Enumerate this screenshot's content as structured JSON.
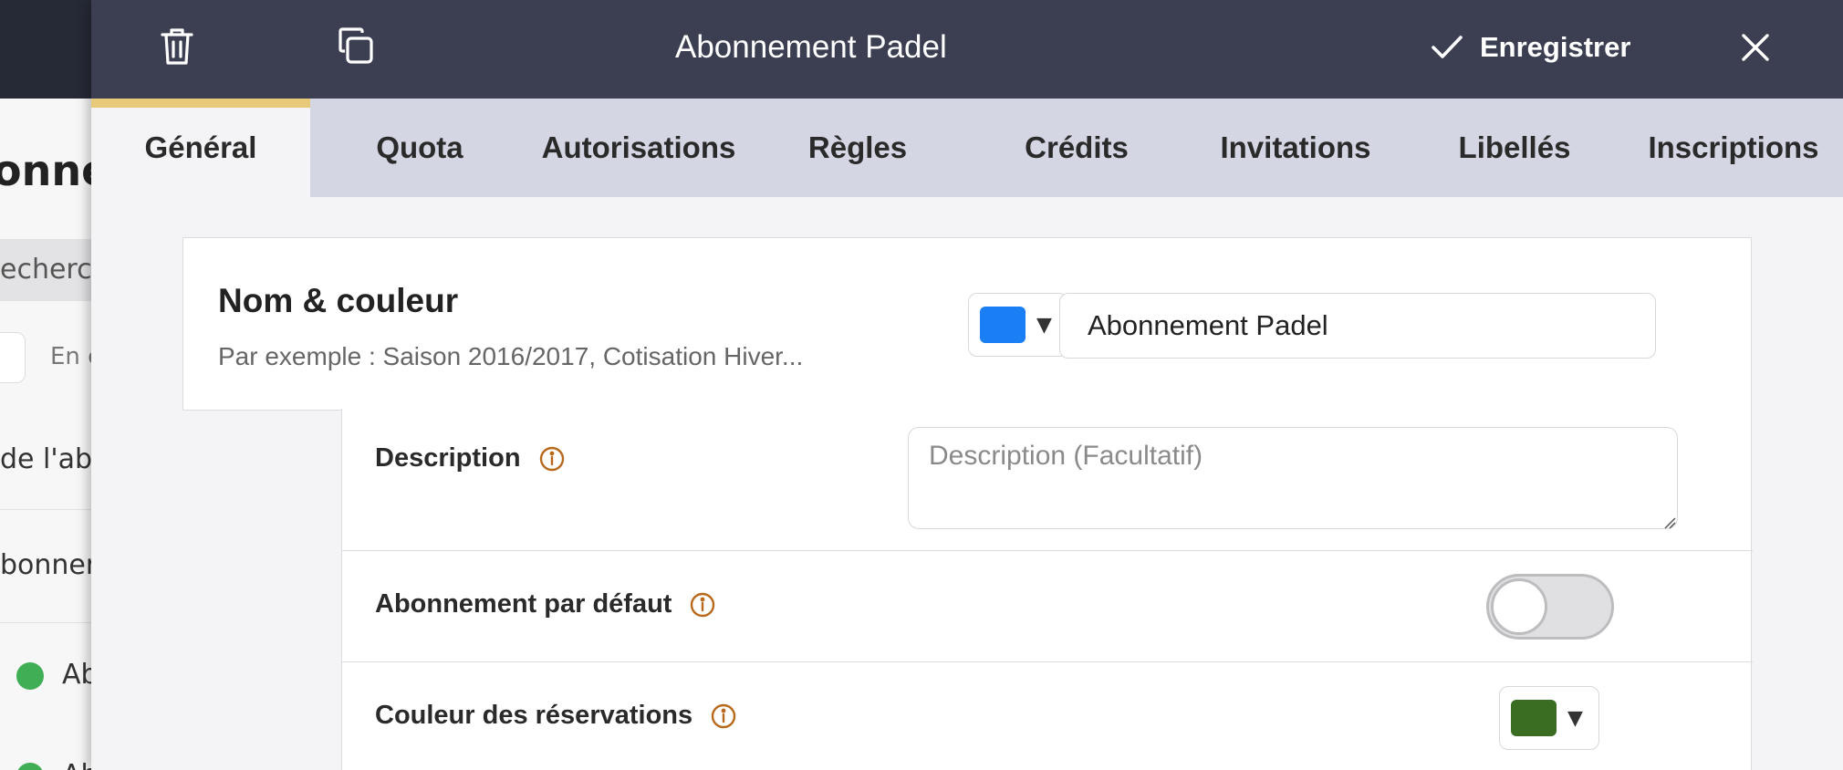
{
  "background": {
    "title_fragment": "onne",
    "search_fragment": "echercl",
    "chip_fragment": "En c",
    "row1_fragment": "de l'abo",
    "row2_fragment": "bonner",
    "item1_fragment": "Ab",
    "item2_fragment": "Ab"
  },
  "header": {
    "title": "Abonnement Padel",
    "save_label": "Enregistrer",
    "icons": [
      "trash-icon",
      "duplicate-icon",
      "check-icon",
      "close-icon"
    ]
  },
  "tabs": [
    {
      "label": "Général",
      "active": true
    },
    {
      "label": "Quota",
      "active": false
    },
    {
      "label": "Autorisations",
      "active": false
    },
    {
      "label": "Règles",
      "active": false
    },
    {
      "label": "Crédits",
      "active": false
    },
    {
      "label": "Invitations",
      "active": false
    },
    {
      "label": "Libellés",
      "active": false
    },
    {
      "label": "Inscriptions",
      "active": false
    }
  ],
  "name_section": {
    "title": "Nom & couleur",
    "subtitle": "Par exemple : Saison 2016/2017, Cotisation Hiver...",
    "color": "#1a7ef5",
    "name_value": "Abonnement Padel"
  },
  "description": {
    "label": "Description",
    "placeholder": "Description (Facultatif)",
    "value": ""
  },
  "default_subscription": {
    "label": "Abonnement par défaut",
    "enabled": false
  },
  "booking_color": {
    "label": "Couleur des réservations",
    "color": "#3a6d22"
  },
  "colors": {
    "header_bg": "#3c3f52",
    "tabs_bg": "#d4d7e3",
    "active_tab_accent": "#e8c97a",
    "info_icon": "#b8691c"
  }
}
